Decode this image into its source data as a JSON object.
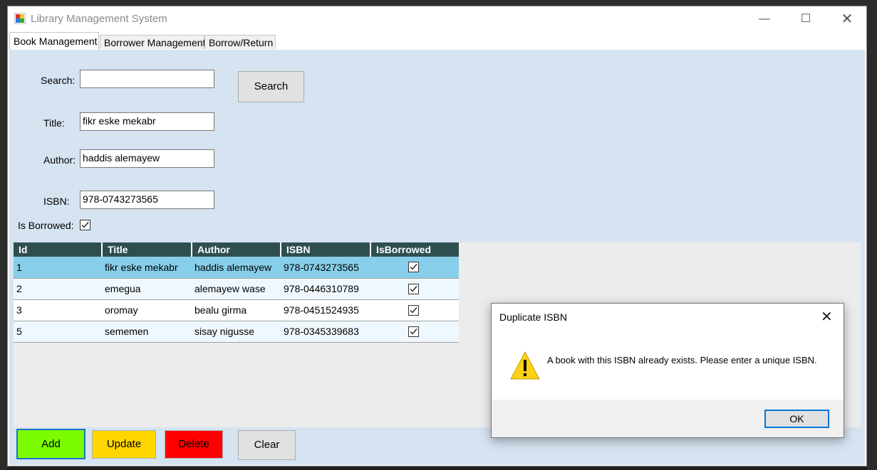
{
  "window": {
    "title": "Library Management System",
    "minimize_glyph": "—",
    "maximize_glyph": "☐",
    "close_glyph": "✕"
  },
  "tabs": [
    {
      "label": "Book Management",
      "active": true
    },
    {
      "label": "Borrower Management",
      "active": false
    },
    {
      "label": "Borrow/Return",
      "active": false
    }
  ],
  "form": {
    "search_label": "Search:",
    "search_value": "",
    "search_button": "Search",
    "title_label": "Title:",
    "title_value": "fikr eske mekabr",
    "author_label": "Author:",
    "author_value": "haddis alemayew",
    "isbn_label": "ISBN:",
    "isbn_value": "978-0743273565",
    "borrowed_label": "Is Borrowed:",
    "borrowed_checked": true
  },
  "grid": {
    "columns": [
      "Id",
      "Title",
      "Author",
      "ISBN",
      "IsBorrowed"
    ],
    "rows": [
      {
        "id": "1",
        "title": "fikr eske mekabr",
        "author": "haddis alemayew",
        "isbn": "978-0743273565",
        "borrowed": true,
        "selected": true
      },
      {
        "id": "2",
        "title": "emegua",
        "author": "alemayew wase",
        "isbn": "978-0446310789",
        "borrowed": true
      },
      {
        "id": "3",
        "title": "oromay",
        "author": "bealu girma",
        "isbn": "978-0451524935",
        "borrowed": true
      },
      {
        "id": "5",
        "title": "sememen",
        "author": "sisay nigusse",
        "isbn": "978-0345339683",
        "borrowed": true
      }
    ]
  },
  "buttons": {
    "add": "Add",
    "update": "Update",
    "delete": "Delete",
    "clear": "Clear"
  },
  "dialog": {
    "title": "Duplicate ISBN",
    "close_glyph": "✕",
    "message": "A book with this ISBN already exists. Please enter a unique ISBN.",
    "ok": "OK",
    "icon": "warning-icon"
  },
  "colors": {
    "page_bg": "#d6e3f1",
    "grid_header": "#2f4f4f",
    "selected_row": "#87ceeb",
    "add": "#7cfc00",
    "update": "#ffd700",
    "delete": "#ff0000"
  }
}
